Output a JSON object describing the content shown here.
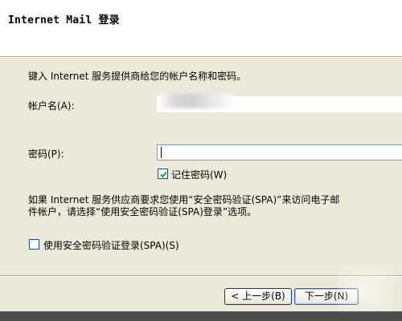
{
  "header": {
    "title": "Internet Mail 登录"
  },
  "intro": "键入 Internet 服务提供商给您的帐户名称和密码。",
  "account": {
    "label": "帐户名(A):",
    "value": ""
  },
  "password": {
    "label": "密码(P):",
    "value": ""
  },
  "remember": {
    "label": "记住密码(W)",
    "checked": true
  },
  "note": {
    "line1": "如果 Internet 服务供应商要求您使用“安全密码验证(SPA)”来访问电子邮",
    "line2": "件帐户，请选择“使用安全密码验证(SPA)登录”选项。"
  },
  "spa": {
    "label": "使用安全密码验证登录(SPA)(S)",
    "checked": false
  },
  "buttons": {
    "back": "< 上一步(B)",
    "next": "下一步(N)"
  }
}
